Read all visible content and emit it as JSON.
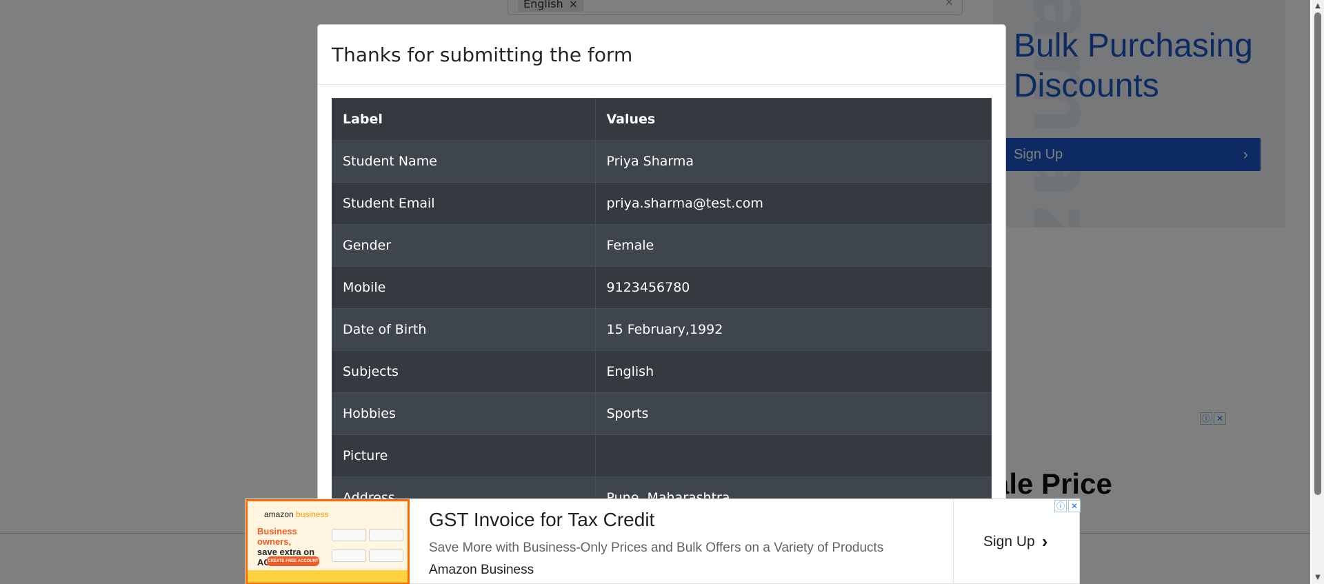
{
  "background": {
    "subjects_chip": "English",
    "chip_close": "×",
    "input_close": "×",
    "right_ad": {
      "headline": "Bulk Purchasing Discounts",
      "button": "Sign Up",
      "watermark": "amazon"
    },
    "mid_ad": {
      "title_fragment": "ale Price"
    }
  },
  "modal": {
    "title": "Thanks for submitting the form",
    "table": {
      "headers": [
        "Label",
        "Values"
      ],
      "rows": [
        [
          "Student Name",
          "Priya Sharma"
        ],
        [
          "Student Email",
          "priya.sharma@test.com"
        ],
        [
          "Gender",
          "Female"
        ],
        [
          "Mobile",
          "9123456780"
        ],
        [
          "Date of Birth",
          "15 February,1992"
        ],
        [
          "Subjects",
          "English"
        ],
        [
          "Hobbies",
          "Sports"
        ],
        [
          "Picture",
          ""
        ],
        [
          "Address",
          "Pune, Maharashtra"
        ]
      ]
    }
  },
  "bottom_ad": {
    "title": "GST Invoice for Tax Credit",
    "description": "Save More with Business-Only Prices and Bulk Offers on a Variety of Products",
    "brand": "Amazon Business",
    "cta": "Sign Up",
    "image": {
      "brand_word": "amazon",
      "brand_suffix": " business",
      "tagline_1": "Business owners,",
      "tagline_2": "save extra on ACs",
      "button": "CREATE FREE ACCOUNT"
    }
  },
  "ad_badges": {
    "info": "ⓘ",
    "close": "✕"
  },
  "colors": {
    "overlay": "rgba(0,0,0,0.5)",
    "table_dark": "#343a40",
    "table_stripe": "#3f454c",
    "ad_blue": "#1a56c4",
    "ad_orange": "#f15a24"
  }
}
